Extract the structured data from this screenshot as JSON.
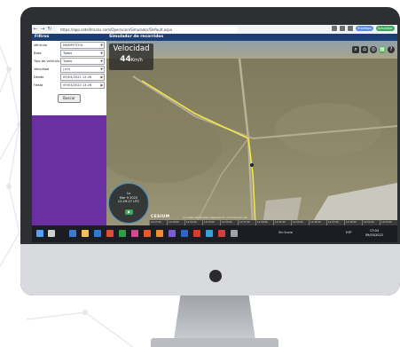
{
  "browser": {
    "url": "https://app.satelitracks.com/Operacion/Simulador/Default.aspx",
    "ext_labels": [
      "Procesos",
      "Actualizar"
    ]
  },
  "sidebar": {
    "title": "Filtros",
    "fields": [
      {
        "label": "Vehículo",
        "value": "MAMPSTOOL",
        "control": "select"
      },
      {
        "label": "Base",
        "value": "Todos",
        "control": "select"
      },
      {
        "label": "Tipo de vehículo",
        "value": "Todos",
        "control": "select"
      },
      {
        "label": "Velocidad",
        "value": "(>0)",
        "control": "select"
      },
      {
        "label": "Desde",
        "value": "09/03/2022 12:26",
        "control": "date"
      },
      {
        "label": "Hasta",
        "value": "09/03/2022 13:26",
        "control": "date"
      }
    ],
    "search_label": "Buscar"
  },
  "main": {
    "title": "Simulador de recorridos",
    "speed_title": "Velocidad",
    "speed_value": "44",
    "speed_unit": "Km/h",
    "tools": [
      "search-icon",
      "home-icon",
      "globe-icon",
      "layers-icon",
      "help-icon"
    ],
    "gauge": {
      "speed": "1x",
      "date": "Mar 9 2022",
      "time": "12:29:27 UTC",
      "play": "▶︎"
    },
    "cesium_label": "CESIUM",
    "credits": "ion  Data attribution  Upgrade for commercial use",
    "timeline_ticks": [
      "12:27:00",
      "12:29:00",
      "12:31:00",
      "12:33:00",
      "12:35:00",
      "12:37:00",
      "12:39:00",
      "12:41:00",
      "12:43:00",
      "12:45:00",
      "12:47:00",
      "12:49:00",
      "12:51:00",
      "12:53:00"
    ]
  },
  "taskbar": {
    "weather": "Sin lluvia",
    "lang": "ESP",
    "time": "17:04",
    "date": "09/03/2022"
  },
  "colors": {
    "header_blue": "#1c3e74",
    "sidebar_purple": "#6a2fa0",
    "route_yellow": "#f2e44a"
  }
}
